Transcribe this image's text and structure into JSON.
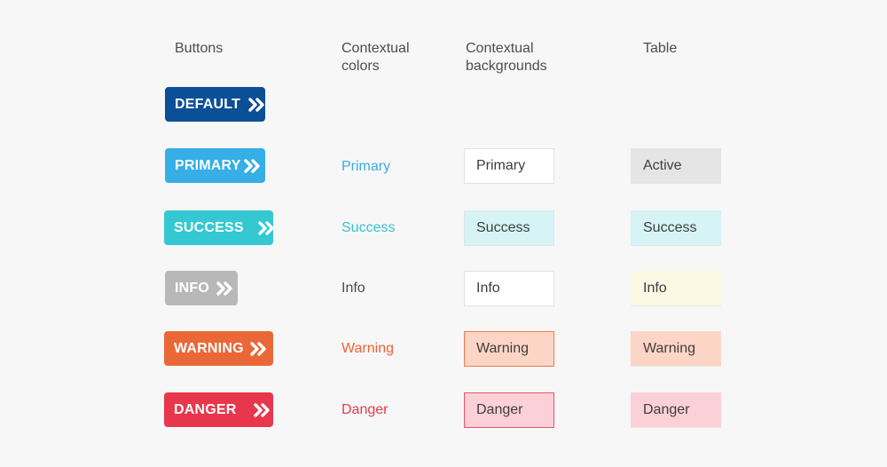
{
  "headers": {
    "buttons": [
      "Buttons"
    ],
    "contextual_colors": [
      "Contextual",
      "colors"
    ],
    "contextual_backgrounds": [
      "Contextual",
      "backgrounds"
    ],
    "table": [
      "Table"
    ]
  },
  "buttons": [
    {
      "label": "DEFAULT",
      "icon": "double-chevron-right-icon",
      "color": "#0b4f96"
    },
    {
      "label": "PRIMARY",
      "icon": "double-chevron-right-icon",
      "color": "#36aee6"
    },
    {
      "label": "SUCCESS",
      "icon": "double-chevron-right-icon",
      "color": "#34c8d2"
    },
    {
      "label": "INFO",
      "icon": "double-chevron-right-icon",
      "color": "#b8b8b8"
    },
    {
      "label": "WARNING",
      "icon": "double-chevron-right-icon",
      "color": "#ea6837"
    },
    {
      "label": "DANGER",
      "icon": "double-chevron-right-icon",
      "color": "#e8374d"
    }
  ],
  "contextual_colors": [
    {
      "label": "Primary",
      "color": "#3aaee3"
    },
    {
      "label": "Success",
      "color": "#35c3cf"
    },
    {
      "label": "Info",
      "color": "#4a4a4a"
    },
    {
      "label": "Warning",
      "color": "#ea6535"
    },
    {
      "label": "Danger",
      "color": "#e63a4e"
    }
  ],
  "contextual_backgrounds": [
    {
      "label": "Primary",
      "background": "#ffffff",
      "border": "#e2e2e2"
    },
    {
      "label": "Success",
      "background": "#d6f3f6",
      "border": "#dde7e9"
    },
    {
      "label": "Info",
      "background": "#ffffff",
      "border": "#e2e2e2"
    },
    {
      "label": "Warning",
      "background": "#fdd5c6",
      "border": "#ef7a4e"
    },
    {
      "label": "Danger",
      "background": "#fcd0d7",
      "border": "#e8546a"
    }
  ],
  "table": [
    {
      "label": "Active",
      "background": "#e5e5e5"
    },
    {
      "label": "Success",
      "background": "#d6f3f6"
    },
    {
      "label": "Info",
      "background": "#fbf8e3"
    },
    {
      "label": "Warning",
      "background": "#fdd5c6"
    },
    {
      "label": "Danger",
      "background": "#fcd0d7"
    }
  ]
}
